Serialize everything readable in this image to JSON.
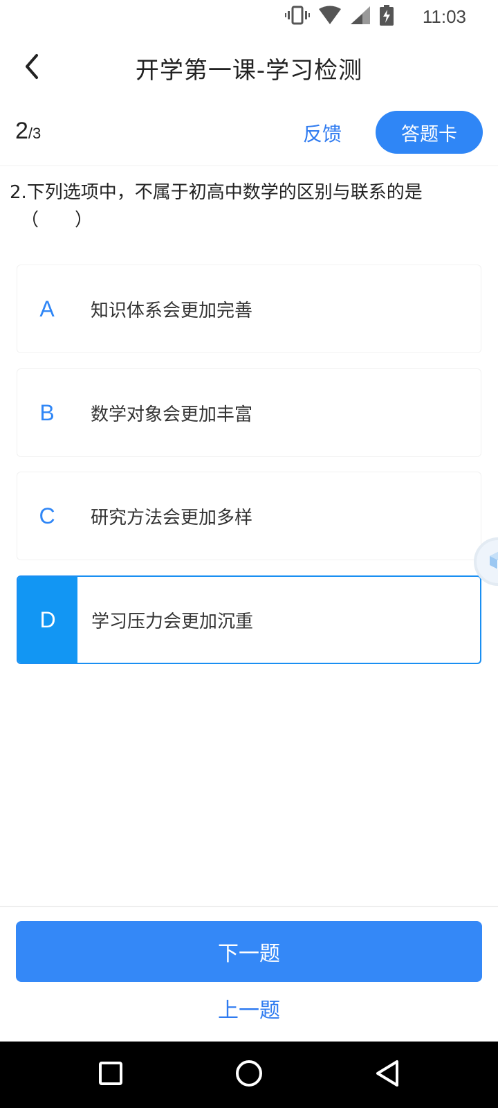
{
  "status_bar": {
    "time": "11:03",
    "icons": [
      "vibrate-icon",
      "wifi-icon",
      "signal-icon",
      "battery-charging-icon"
    ]
  },
  "header": {
    "title": "开学第一课-学习检测",
    "back_icon": "chevron-left-icon"
  },
  "sub_header": {
    "current": "2",
    "total": "/3",
    "feedback_label": "反馈",
    "answer_card_label": "答题卡"
  },
  "question": {
    "text": "2.下列选项中，不属于初高中数学的区别与联系的是",
    "blank": "（　　）"
  },
  "options": [
    {
      "letter": "A",
      "text": "知识体系会更加完善",
      "selected": false
    },
    {
      "letter": "B",
      "text": "数学对象会更加丰富",
      "selected": false
    },
    {
      "letter": "C",
      "text": "研究方法会更加多样",
      "selected": false
    },
    {
      "letter": "D",
      "text": "学习压力会更加沉重",
      "selected": true
    }
  ],
  "buttons": {
    "next_label": "下一题",
    "prev_label": "上一题"
  },
  "colors": {
    "accent": "#2f86f6",
    "selected_letter_bg": "#1296f3",
    "nav_bar": "#000000"
  },
  "nav_bar": {
    "icons": [
      "recent-apps-square-icon",
      "home-circle-icon",
      "back-triangle-icon"
    ]
  }
}
